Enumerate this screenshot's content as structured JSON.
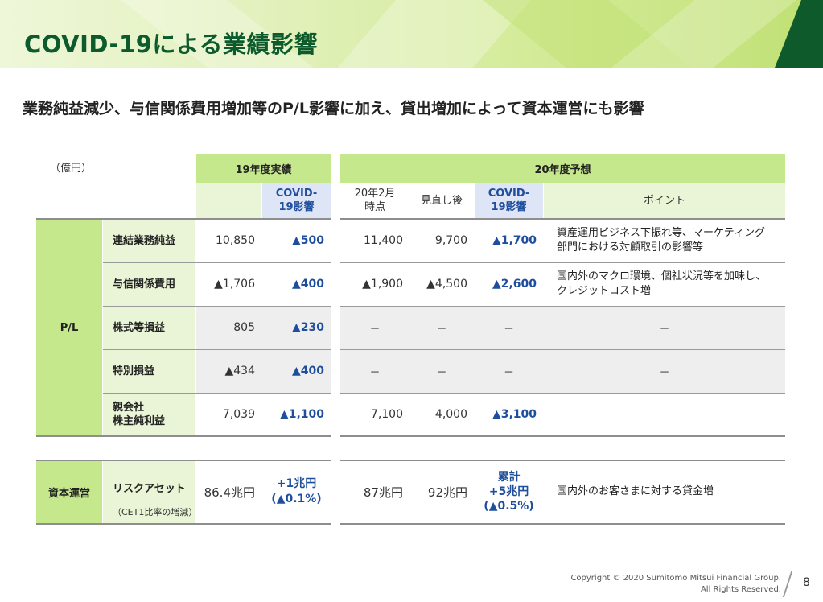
{
  "header": {
    "title": "COVID-19による業績影響"
  },
  "subtitle": "業務純益減少、与信関係費用増加等のP/L影響に加え、貸出増加によって資本運営にも影響",
  "unit": "（億円）",
  "columns": {
    "fy19_group": "19年度実績",
    "fy20_group": "20年度予想",
    "fy19_covid": "COVID-\n19影響",
    "fy20_feb": "20年2月\n時点",
    "fy20_revised": "見直し後",
    "fy20_covid": "COVID-\n19影響",
    "fy20_point": "ポイント"
  },
  "pl": {
    "category": "P/L",
    "rows": [
      {
        "label": "連結業務純益",
        "fy19": "10,850",
        "fy19_covid": "▲500",
        "fy20_feb": "11,400",
        "fy20_revised": "9,700",
        "fy20_covid": "▲1,700",
        "point": "資産運用ビジネス下振れ等、マーケティング\n部門における対顧取引の影響等"
      },
      {
        "label": "与信関係費用",
        "fy19": "▲1,706",
        "fy19_covid": "▲400",
        "fy20_feb": "▲1,900",
        "fy20_revised": "▲4,500",
        "fy20_covid": "▲2,600",
        "point": "国内外のマクロ環境、個社状況等を加味し、\nクレジットコスト増"
      },
      {
        "label": "株式等損益",
        "fy19": "805",
        "fy19_covid": "▲230",
        "fy20_feb": "－",
        "fy20_revised": "－",
        "fy20_covid": "－",
        "point": "－"
      },
      {
        "label": "特別損益",
        "fy19": "▲434",
        "fy19_covid": "▲400",
        "fy20_feb": "－",
        "fy20_revised": "－",
        "fy20_covid": "－",
        "point": "－"
      },
      {
        "label": "親会社\n株主純利益",
        "fy19": "7,039",
        "fy19_covid": "▲1,100",
        "fy20_feb": "7,100",
        "fy20_revised": "4,000",
        "fy20_covid": "▲3,100",
        "point": ""
      }
    ]
  },
  "capital": {
    "category": "資本運営",
    "label": "リスクアセット",
    "note": "（CET1比率の増減）",
    "fy19": "86.4兆円",
    "fy19_covid": "+1兆円\n(▲0.1%)",
    "fy20_feb": "87兆円",
    "fy20_revised": "92兆円",
    "fy20_covid": "累計\n+5兆円\n(▲0.5%)",
    "point": "国内外のお客さまに対する貸金増"
  },
  "footer": {
    "copyright": "Copyright © 2020 Sumitomo Mitsui Financial Group.",
    "rights": "All Rights Reserved.",
    "page": "8"
  },
  "colors": {
    "title_green": "#0d5b2c",
    "header_green": "#c6e88c",
    "label_light_green": "#e9f5d6",
    "covid_header_blue": "#dee5f6",
    "covid_text_blue": "#1f4e9c"
  }
}
